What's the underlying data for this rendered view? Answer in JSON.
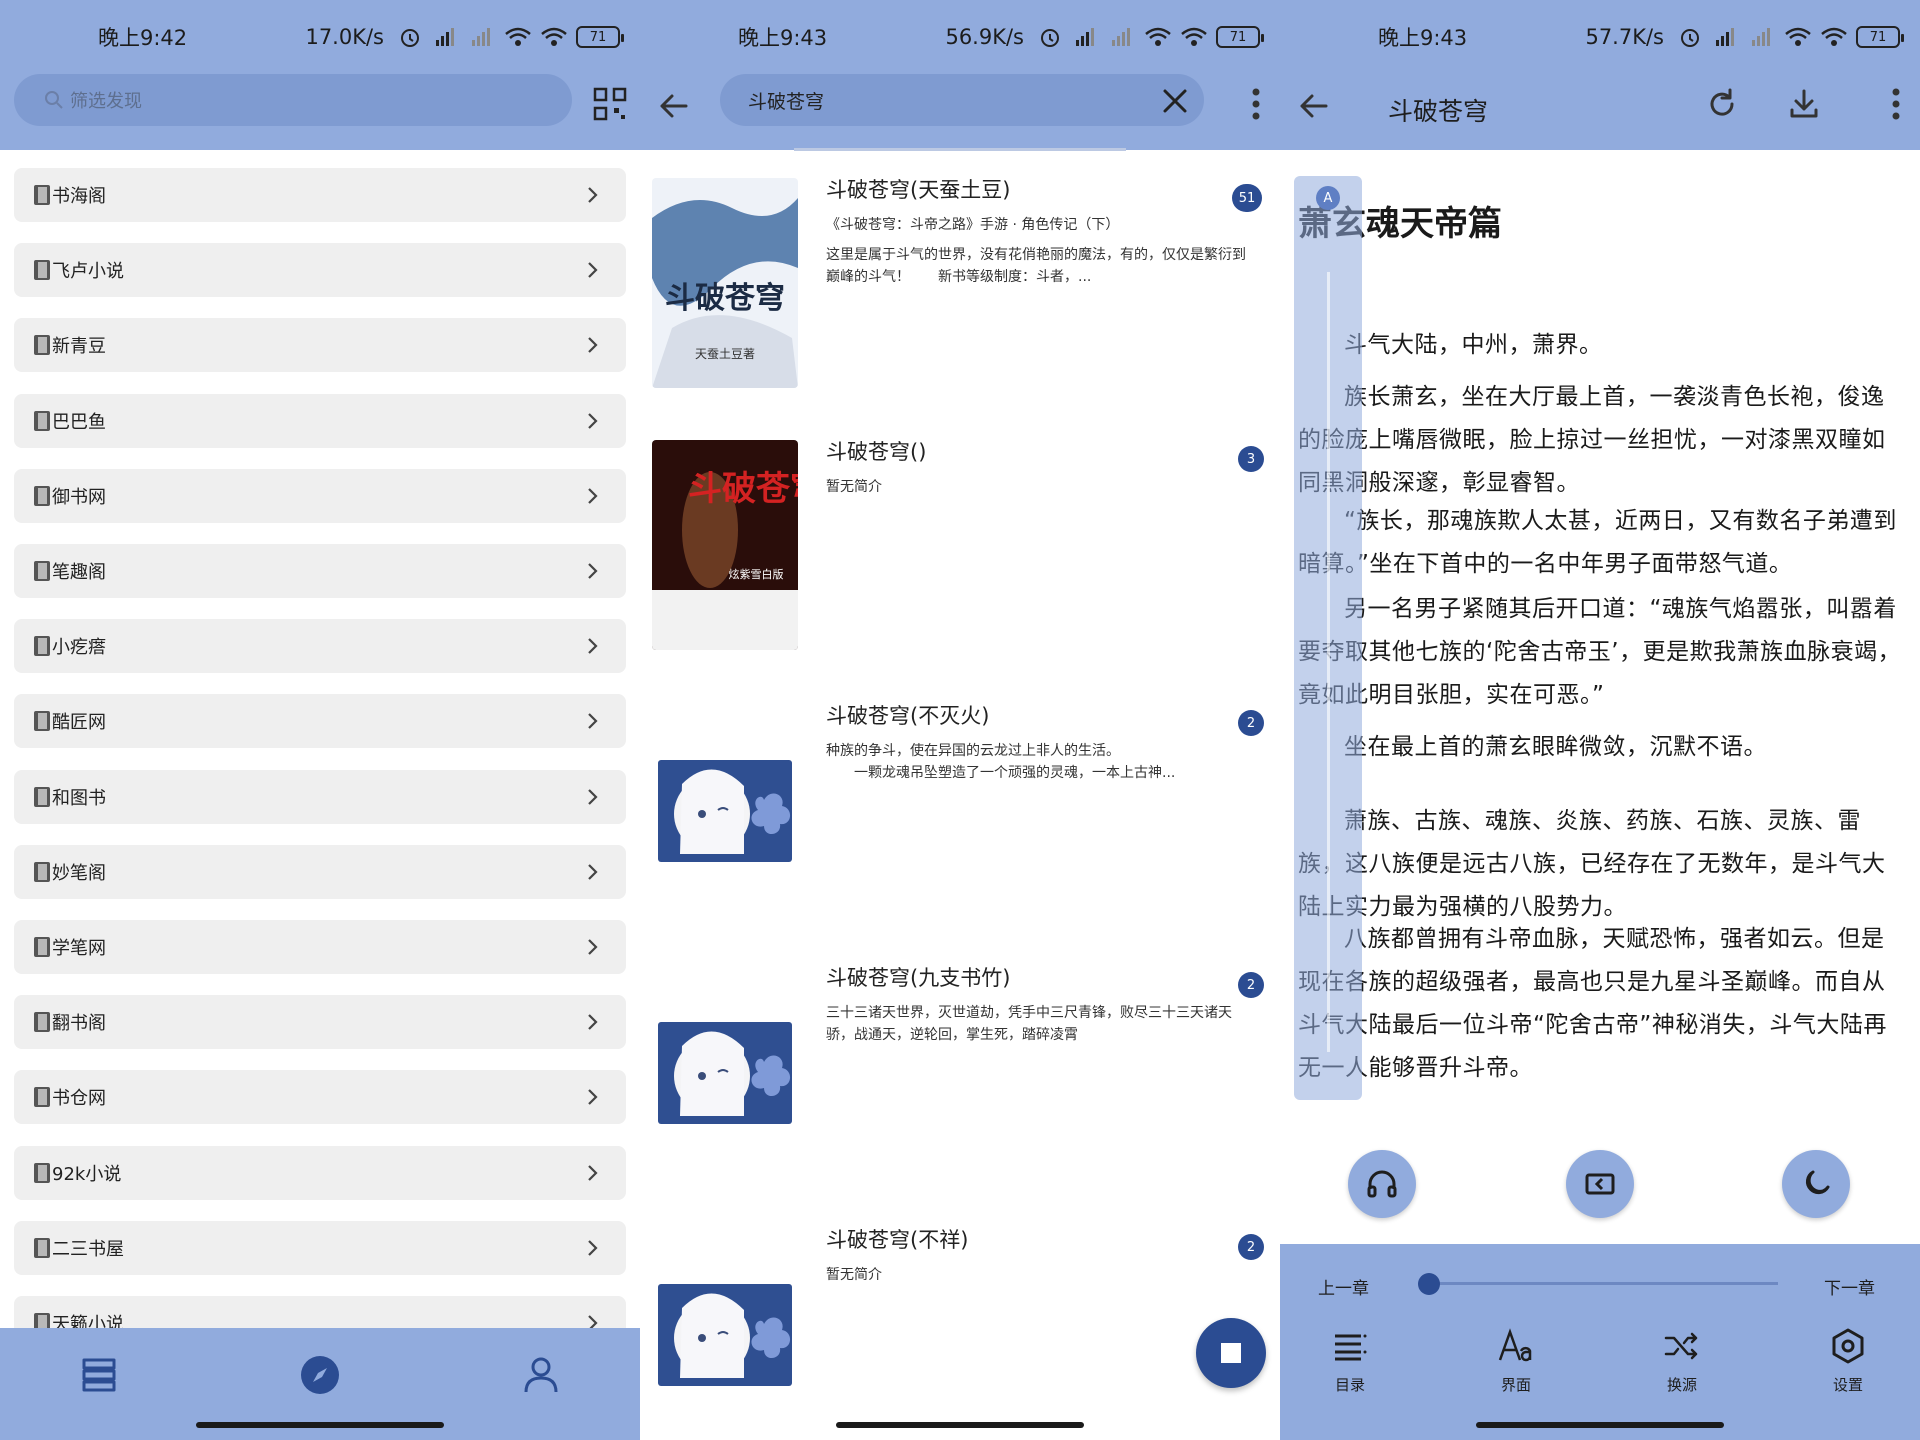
{
  "panel1": {
    "status": {
      "time": "晚上9:42",
      "speed": "17.0K/s",
      "battery": "71"
    },
    "search_placeholder": "筛选发现",
    "sources": [
      "书海阁",
      "飞卢小说",
      "新青豆",
      "巴巴鱼",
      "御书网",
      "笔趣阁",
      "小疙瘩",
      "酷匠网",
      "和图书",
      "妙笔阁",
      "学笔网",
      "翻书阁",
      "书仓网",
      "92k小说",
      "二三书屋",
      "天籁小说"
    ]
  },
  "panel2": {
    "status": {
      "time": "晚上9:43",
      "speed": "56.9K/s",
      "battery": "71"
    },
    "query": "斗破苍穹",
    "results": [
      {
        "title": "斗破苍穹(天蚕土豆)",
        "meta": "《斗破苍穹：斗帝之路》手游 · 角色传记（下）",
        "desc": "这里是属于斗气的世界，没有花俏艳丽的魔法，有的，仅仅是繁衍到巅峰的斗气！　　新书等级制度：斗者，...",
        "count": "51"
      },
      {
        "title": "斗破苍穹()",
        "meta": "暂无简介",
        "desc": "",
        "count": "3"
      },
      {
        "title": "斗破苍穹(不灭火)",
        "meta": "种族的争斗，使在异国的云龙过上非人的生活。",
        "desc": "　　一颗龙魂吊坠塑造了一个顽强的灵魂，一本上古神...",
        "count": "2"
      },
      {
        "title": "斗破苍穹(九支书竹)",
        "meta": "三十三诸天世界，灭世道劫，凭手中三尺青锋，败尽三十三天诸天骄，战通天，逆轮回，掌生死，踏碎凌霄",
        "desc": "",
        "count": "2"
      },
      {
        "title": "斗破苍穹(不祥)",
        "meta": "暂无简介",
        "desc": "",
        "count": "2"
      }
    ],
    "cover1_text": "斗破苍穹",
    "cover1_sub": "天蚕土豆著",
    "cover2_text": "斗破苍穹",
    "cover2_sub": "炫紫雪白版"
  },
  "panel3": {
    "status": {
      "time": "晚上9:43",
      "speed": "57.7K/s",
      "battery": "71"
    },
    "book_title": "斗破苍穹",
    "chapter_title": "萧玄魂天帝篇",
    "scroll_badge": "A",
    "paragraphs": [
      "斗气大陆，中州，萧界。",
      "族长萧玄，坐在大厅最上首，一袭淡青色长袍，俊逸的脸庞上嘴唇微眠，脸上掠过一丝担忧，一对漆黑双瞳如同黑洞般深邃，彰显睿智。",
      "“族长，那魂族欺人太甚，近两日，又有数名子弟遭到暗算。”坐在下首中的一名中年男子面带怒气道。",
      "另一名男子紧随其后开口道：“魂族气焰嚣张，叫嚣着要夺取其他七族的‘陀舍古帝玉’，更是欺我萧族血脉衰竭，竟如此明目张胆，实在可恶。”",
      "坐在最上首的萧玄眼眸微敛，沉默不语。",
      "萧族、古族、魂族、炎族、药族、石族、灵族、雷族，这八族便是远古八族，已经存在了无数年，是斗气大陆上实力最为强横的八股势力。",
      "八族都曾拥有斗帝血脉，天赋恐怖，强者如云。但是现在各族的超级强者，最高也只是九星斗圣巅峰。而自从斗气大陆最后一位斗帝“陀舍古帝”神秘消失，斗气大陆再无一人能够晋升斗帝。"
    ],
    "prev_chapter": "上一章",
    "next_chapter": "下一章",
    "progress": 0,
    "tools": [
      "目录",
      "界面",
      "换源",
      "设置"
    ]
  },
  "colors": {
    "bar": "#91abdd",
    "accent": "#2b4c92",
    "item_bg": "#efefef"
  }
}
